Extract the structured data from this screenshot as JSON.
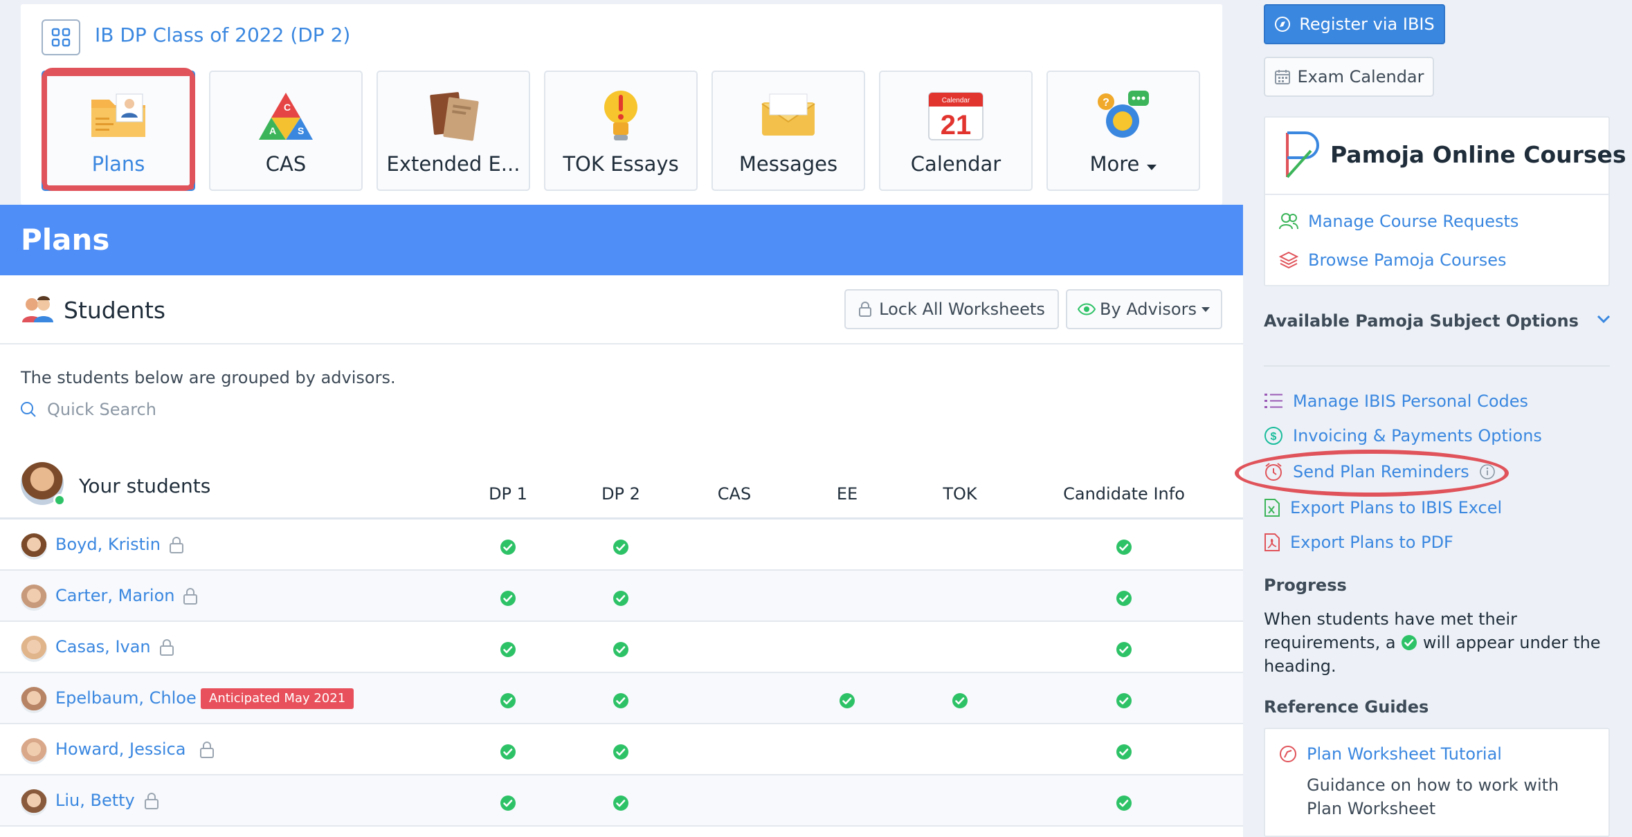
{
  "header": {
    "class_title": "IB DP Class of 2022 (DP 2)",
    "tiles": [
      {
        "label": "Plans"
      },
      {
        "label": "CAS"
      },
      {
        "label": "Extended E..."
      },
      {
        "label": "TOK Essays"
      },
      {
        "label": "Messages"
      },
      {
        "label": "Calendar"
      },
      {
        "label": "More"
      }
    ],
    "calendar_icon": {
      "month": "Calendar",
      "day": "21"
    }
  },
  "plans": {
    "title": "Plans",
    "students_heading": "Students",
    "lock_all_label": "Lock All Worksheets",
    "by_advisors_label": "By Advisors",
    "description": "The students below are grouped by advisors.",
    "search_placeholder": "Quick Search",
    "group_title": "Your students",
    "columns": [
      "DP 1",
      "DP 2",
      "CAS",
      "EE",
      "TOK",
      "Candidate Info"
    ],
    "students": [
      {
        "name": "Boyd, Kristin",
        "locked": true,
        "badge": "",
        "checks": [
          true,
          true,
          false,
          false,
          false,
          true
        ]
      },
      {
        "name": "Carter, Marion",
        "locked": true,
        "badge": "",
        "checks": [
          true,
          true,
          false,
          false,
          false,
          true
        ]
      },
      {
        "name": "Casas, Ivan",
        "locked": true,
        "badge": "",
        "checks": [
          true,
          true,
          false,
          false,
          false,
          true
        ]
      },
      {
        "name": "Epelbaum, Chloe",
        "locked": false,
        "badge": "Anticipated May 2021",
        "checks": [
          true,
          true,
          false,
          true,
          true,
          true
        ]
      },
      {
        "name": "Howard, Jessica",
        "locked": true,
        "badge": "",
        "checks": [
          true,
          true,
          false,
          false,
          false,
          true
        ]
      },
      {
        "name": "Liu, Betty",
        "locked": true,
        "badge": "",
        "checks": [
          true,
          true,
          false,
          false,
          false,
          true
        ]
      }
    ]
  },
  "sidebar": {
    "register_label": "Register via IBIS",
    "exam_calendar_label": "Exam Calendar",
    "pamoja_title": "Pamoja Online Courses",
    "manage_requests": "Manage Course Requests",
    "browse_courses": "Browse Pamoja Courses",
    "available_options": "Available Pamoja Subject Options",
    "links": [
      "Manage IBIS Personal Codes",
      "Invoicing & Payments Options",
      "Send Plan Reminders",
      "Export Plans to IBIS Excel",
      "Export Plans to PDF"
    ],
    "progress_heading": "Progress",
    "progress_text_1": "When students have met their requirements, a",
    "progress_text_2": "will appear under the heading.",
    "reference_heading": "Reference Guides",
    "guide_title": "Plan Worksheet Tutorial",
    "guide_desc": "Guidance on how to work with Plan Worksheet"
  },
  "colors": {
    "brand_blue": "#4f8ef7",
    "link_blue": "#3a87e0",
    "check_green": "#2ec267",
    "highlight_red": "#e0535a",
    "badge_red": "#e8505b"
  }
}
